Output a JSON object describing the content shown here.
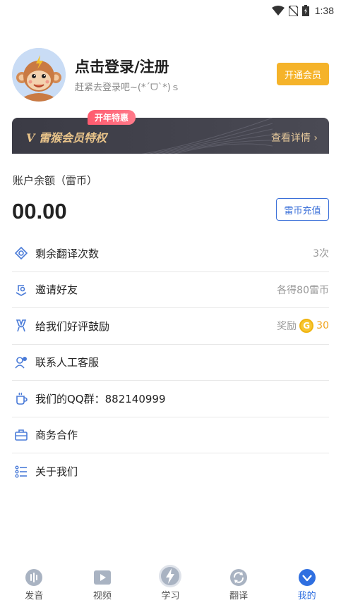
{
  "status_bar": {
    "time": "1:38"
  },
  "profile": {
    "login_title": "点击登录/注册",
    "login_subtitle": "赶紧去登录吧~(*ˊᗜˋ*)ｓ",
    "vip_button": "开通会员"
  },
  "vip_banner": {
    "promo_tag": "开年特惠",
    "title": "V 雷猴会员特权",
    "detail": "查看详情 ›"
  },
  "account": {
    "balance_label": "账户余额（雷币）",
    "balance_value": "00.00",
    "recharge_button": "雷币充值"
  },
  "menu": {
    "items": [
      {
        "icon": "translate-count-icon",
        "label": "剩余翻译次数",
        "value": "3次"
      },
      {
        "icon": "invite-icon",
        "label": "邀请好友",
        "value": "各得80雷币"
      },
      {
        "icon": "review-icon",
        "label": "给我们好评鼓励",
        "value": "奖励",
        "coin": "G",
        "coin_value": "30"
      },
      {
        "icon": "customer-service-icon",
        "label": "联系人工客服",
        "value": ""
      },
      {
        "icon": "qq-group-icon",
        "label": "我们的QQ群：882140999",
        "value": ""
      },
      {
        "icon": "business-icon",
        "label": "商务合作",
        "value": ""
      },
      {
        "icon": "about-icon",
        "label": "关于我们",
        "value": ""
      }
    ]
  },
  "tabbar": {
    "tabs": [
      {
        "label": "发音",
        "icon": "pronounce-icon"
      },
      {
        "label": "视频",
        "icon": "video-icon"
      },
      {
        "label": "学习",
        "icon": "learn-icon"
      },
      {
        "label": "翻译",
        "icon": "translate-icon"
      },
      {
        "label": "我的",
        "icon": "mine-icon",
        "active": true
      }
    ]
  },
  "colors": {
    "accent": "#2f6fe0",
    "vip_gold": "#f5b32a",
    "banner_dark": "#3b3b45",
    "promo_red": "#ff5a6e"
  }
}
